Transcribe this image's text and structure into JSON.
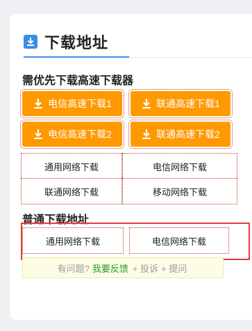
{
  "section": {
    "title": "下载地址",
    "icon": "download-icon",
    "accent": "#3a8ee6"
  },
  "fast": {
    "heading": "需优先下载高速下载器",
    "buttons": [
      {
        "label": "电信高速下载1"
      },
      {
        "label": "联通高速下载1"
      },
      {
        "label": "电信高速下载2"
      },
      {
        "label": "联通高速下载2"
      }
    ],
    "button_color": "#ff9900"
  },
  "network": {
    "buttons": [
      {
        "label": "通用网络下载"
      },
      {
        "label": "电信网络下载"
      },
      {
        "label": "联通网络下载"
      },
      {
        "label": "移动网络下载"
      }
    ]
  },
  "normal": {
    "heading": "普通下载地址",
    "buttons": [
      {
        "label": "通用网络下载"
      },
      {
        "label": "电信网络下载"
      }
    ]
  },
  "feedback": {
    "prefix": "有问题?",
    "link": "我要反馈",
    "complain": "+ 投诉",
    "ask": "+ 提问"
  }
}
